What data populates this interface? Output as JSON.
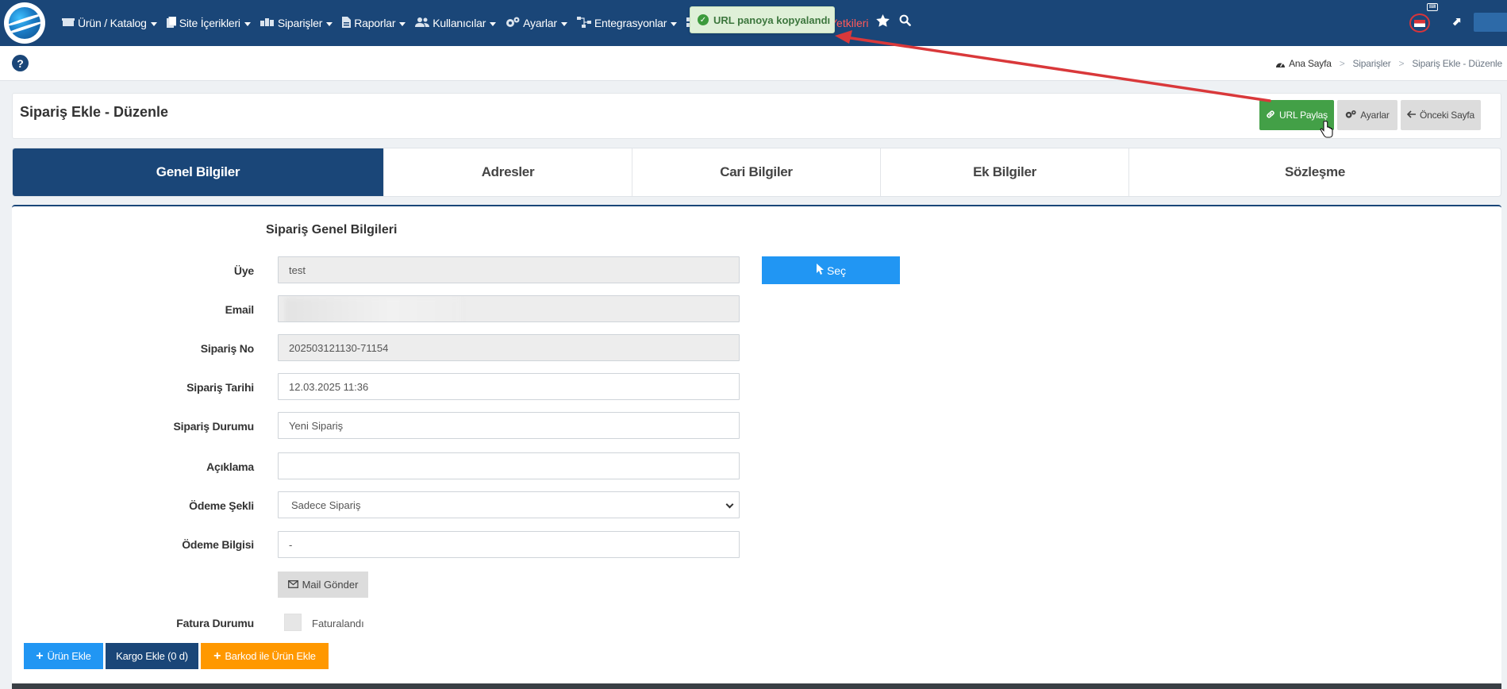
{
  "navbar": {
    "items": [
      {
        "label": "Ürün / Katalog",
        "icon": "box-icon"
      },
      {
        "label": "Site İçerikleri",
        "icon": "file-icon"
      },
      {
        "label": "Siparişler",
        "icon": "cart-icon"
      },
      {
        "label": "Raporlar",
        "icon": "report-icon"
      },
      {
        "label": "Kullanıcılar",
        "icon": "users-icon"
      },
      {
        "label": "Ayarlar",
        "icon": "gears-icon"
      },
      {
        "label": "Entegrasyonlar",
        "icon": "sitemap-icon"
      }
    ],
    "red_partial": "Yetkileri"
  },
  "toast": {
    "message": "URL panoya kopyalandı"
  },
  "breadcrumb": {
    "home": "Ana Sayfa",
    "level1": "Siparişler",
    "level2": "Sipariş Ekle - Düzenle"
  },
  "header": {
    "title": "Sipariş Ekle - Düzenle",
    "url_share": "URL Paylaş",
    "settings": "Ayarlar",
    "previous": "Önceki Sayfa"
  },
  "tabs": [
    {
      "label": "Genel Bilgiler",
      "active": true
    },
    {
      "label": "Adresler",
      "active": false
    },
    {
      "label": "Cari Bilgiler",
      "active": false
    },
    {
      "label": "Ek Bilgiler",
      "active": false
    },
    {
      "label": "Sözleşme",
      "active": false
    }
  ],
  "form": {
    "section_title": "Sipariş Genel Bilgileri",
    "uye_label": "Üye",
    "uye_value": "test",
    "sec_button": "Seç",
    "email_label": "Email",
    "email_value": "",
    "siparis_no_label": "Sipariş No",
    "siparis_no_value": "202503121130-71154",
    "tarih_label": "Sipariş Tarihi",
    "tarih_value": "12.03.2025 11:36",
    "durum_label": "Sipariş Durumu",
    "durum_value": "Yeni Sipariş",
    "aciklama_label": "Açıklama",
    "aciklama_value": "",
    "odeme_sekli_label": "Ödeme Şekli",
    "odeme_sekli_value": "Sadece Sipariş",
    "odeme_bilgisi_label": "Ödeme Bilgisi",
    "odeme_bilgisi_value": "-",
    "mail_button": "Mail Gönder",
    "fatura_label": "Fatura Durumu",
    "fatura_checkbox_label": "Faturalandı"
  },
  "bottom_buttons": {
    "urun_ekle": "Ürün Ekle",
    "kargo_ekle": "Kargo Ekle (0 d)",
    "barkod": "Barkod ile Ürün Ekle"
  },
  "colors": {
    "navbar": "#1a4678",
    "accent_green": "#43a047",
    "accent_blue": "#2196f3",
    "accent_orange": "#ff9800",
    "annotation": "#d9383a"
  }
}
